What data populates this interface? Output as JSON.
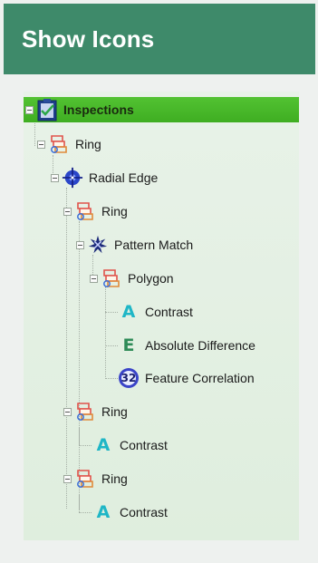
{
  "header": {
    "title": "Show Icons"
  },
  "colors": {
    "header_bg": "#3e8a6a",
    "root_highlight": "#48b82a",
    "contrast_icon": "#1fb6c6",
    "difference_icon": "#2e8b57"
  },
  "tree": {
    "root": {
      "label": "Inspections",
      "icon": "clipboard-check-icon"
    },
    "nodes": [
      {
        "label": "Ring",
        "icon": "ring-tool-icon"
      },
      {
        "label": "Radial Edge",
        "icon": "radial-edge-icon"
      },
      {
        "label": "Ring",
        "icon": "ring-tool-icon"
      },
      {
        "label": "Pattern Match",
        "icon": "pattern-match-icon"
      },
      {
        "label": "Polygon",
        "icon": "polygon-tool-icon"
      },
      {
        "label": "Contrast",
        "icon": "contrast-a-icon",
        "glyph": "A"
      },
      {
        "label": "Absolute Difference",
        "icon": "absolute-difference-e-icon",
        "glyph": "E"
      },
      {
        "label": "Feature Correlation",
        "icon": "feature-correlation-icon",
        "glyph": "32"
      },
      {
        "label": "Ring",
        "icon": "ring-tool-icon"
      },
      {
        "label": "Contrast",
        "icon": "contrast-a-icon",
        "glyph": "A"
      },
      {
        "label": "Ring",
        "icon": "ring-tool-icon"
      },
      {
        "label": "Contrast",
        "icon": "contrast-a-icon",
        "glyph": "A"
      }
    ]
  }
}
